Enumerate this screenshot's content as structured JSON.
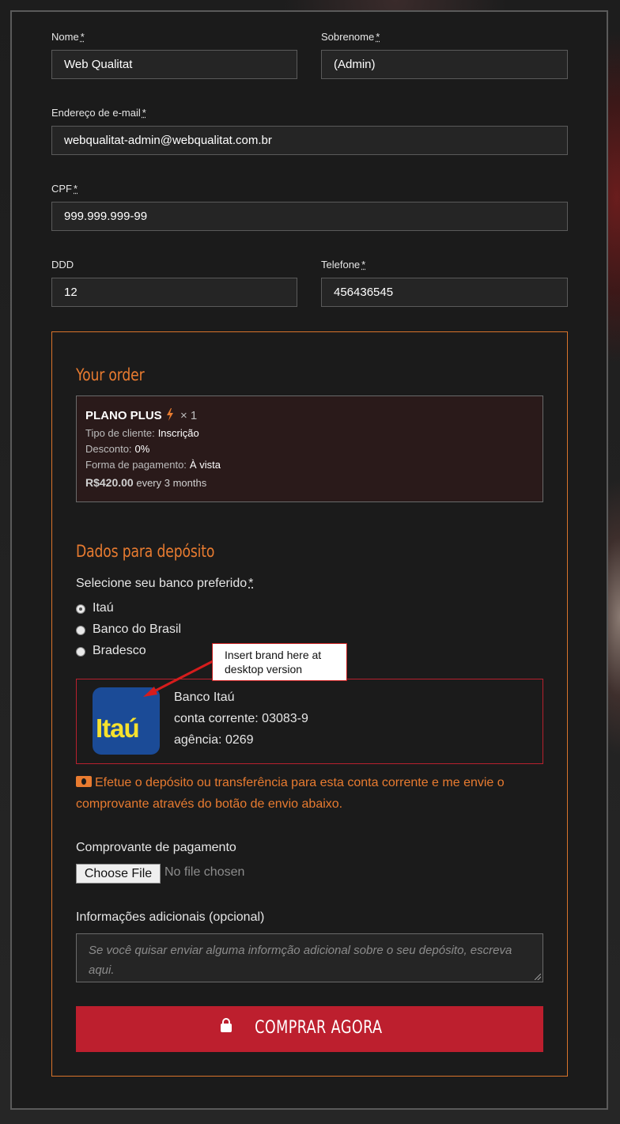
{
  "form": {
    "first_name": {
      "label": "Nome",
      "required_mark": "*",
      "value": "Web Qualitat"
    },
    "last_name": {
      "label": "Sobrenome",
      "required_mark": "*",
      "value": "(Admin)"
    },
    "email": {
      "label": "Endereço de e-mail",
      "required_mark": "*",
      "value": "webqualitat-admin@webqualitat.com.br"
    },
    "cpf": {
      "label": "CPF",
      "required_mark": "*",
      "value": "999.999.999-99"
    },
    "ddd": {
      "label": "DDD",
      "value": "12"
    },
    "phone": {
      "label": "Telefone",
      "required_mark": "*",
      "value": "456436545"
    }
  },
  "order": {
    "heading": "Your order",
    "product_name": "PLANO PLUS",
    "quantity": "× 1",
    "client_type_label": "Tipo de cliente:",
    "client_type_value": "Inscrição",
    "discount_label": "Desconto:",
    "discount_value": "0%",
    "payment_form_label": "Forma de pagamento:",
    "payment_form_value": "À vista",
    "price": "R$420.00",
    "period": "every 3 months"
  },
  "deposit": {
    "heading": "Dados para depósito",
    "bank_select_label": "Selecione seu banco preferido",
    "required_mark": "*",
    "banks": [
      {
        "label": "Itaú",
        "checked": true
      },
      {
        "label": "Banco do Brasil",
        "checked": false
      },
      {
        "label": "Bradesco",
        "checked": false
      }
    ],
    "selected_bank": {
      "logo_text": "Itaú",
      "name": "Banco Itaú",
      "account": "conta corrente: 03083-9",
      "agency": "agência: 0269"
    },
    "callout_text_1": "Insert brand here at",
    "callout_text_2": "desktop version",
    "notice": "Efetue o depósito ou transferência para esta conta corrente e me envie o comprovante através do botão de envio abaixo."
  },
  "upload": {
    "label": "Comprovante de pagamento",
    "button_label": "Choose File",
    "status": "No file chosen"
  },
  "notes": {
    "label": "Informações adicionais (opcional)",
    "placeholder": "Se você quisar enviar alguma informção adicional sobre o seu depósito, escreva aqui."
  },
  "submit": {
    "label": "COMPRAR AGORA"
  },
  "colors": {
    "accent": "#e87b30",
    "button": "#bd1f2e",
    "panel": "#1b1b1b",
    "itau_blue": "#1b4b97",
    "itau_yellow": "#f6e12d"
  }
}
